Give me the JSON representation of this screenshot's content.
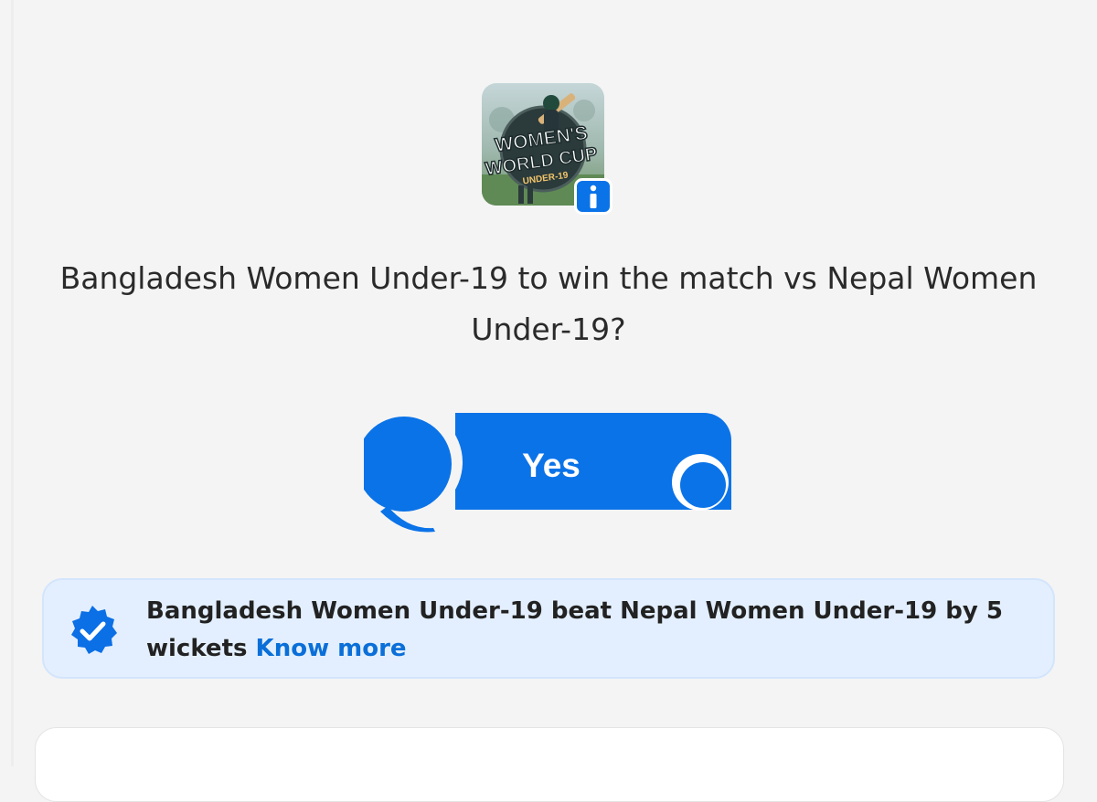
{
  "event": {
    "logo_text": {
      "line1": "WOMEN'S",
      "line2": "WORLD CUP",
      "line3": "UNDER-19"
    },
    "info_icon": "info-icon"
  },
  "question": {
    "text": "Bangladesh Women Under-19 to win the match vs Nepal Women Under-19?"
  },
  "answer": {
    "label": "Yes",
    "color": "#0b73e8"
  },
  "result": {
    "text": "Bangladesh Women Under-19 beat Nepal Women Under-19 by 5 wickets",
    "link_label": "Know more",
    "icon": "verified-badge-icon",
    "background": "#e3effe"
  }
}
